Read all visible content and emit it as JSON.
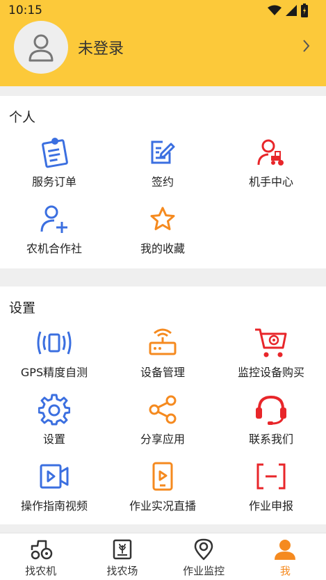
{
  "status": {
    "time": "10:15"
  },
  "profile": {
    "name": "未登录"
  },
  "personal": {
    "title": "个人",
    "items": [
      {
        "label": "服务订单",
        "icon": "clipboard-order-icon"
      },
      {
        "label": "签约",
        "icon": "edit-sign-icon"
      },
      {
        "label": "机手中心",
        "icon": "driver-tractor-icon"
      },
      {
        "label": "农机合作社",
        "icon": "user-add-icon"
      },
      {
        "label": "我的收藏",
        "icon": "star-icon"
      }
    ]
  },
  "settings": {
    "title": "设置",
    "items": [
      {
        "label": "GPS精度自测",
        "icon": "phone-signal-icon"
      },
      {
        "label": "设备管理",
        "icon": "router-device-icon"
      },
      {
        "label": "监控设备购买",
        "icon": "camera-cart-icon"
      },
      {
        "label": "设置",
        "icon": "gear-icon"
      },
      {
        "label": "分享应用",
        "icon": "share-icon"
      },
      {
        "label": "联系我们",
        "icon": "headset-icon"
      },
      {
        "label": "操作指南视频",
        "icon": "video-icon"
      },
      {
        "label": "作业实况直播",
        "icon": "live-play-icon"
      },
      {
        "label": "作业申报",
        "icon": "report-bracket-icon"
      }
    ]
  },
  "tabs": [
    {
      "label": "找农机",
      "icon": "tractor-icon"
    },
    {
      "label": "找农场",
      "icon": "farm-icon"
    },
    {
      "label": "作业监控",
      "icon": "location-pin-icon"
    },
    {
      "label": "我",
      "icon": "person-icon",
      "active": true
    }
  ],
  "colors": {
    "header": "#fcc93a",
    "blue": "#3b6fe0",
    "orange": "#f58a1f",
    "red": "#e8262a",
    "active_tab": "#f58a1f"
  }
}
